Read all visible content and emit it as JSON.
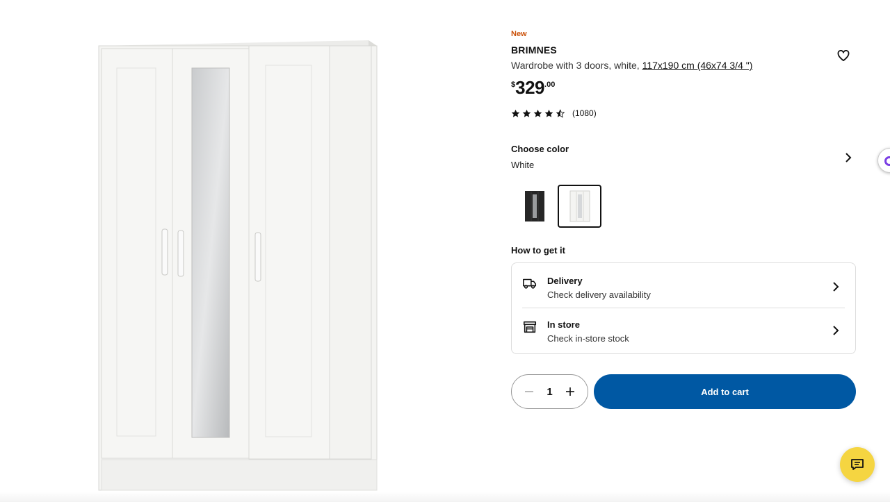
{
  "product": {
    "badge": "New",
    "name": "BRIMNES",
    "description": "Wardrobe with 3 doors, white,",
    "dimensions": "117x190 cm (46x74 3/4 \")",
    "price": {
      "currency": "$",
      "integer": "329",
      "decimal": ".00"
    },
    "rating": {
      "stars": 4.5,
      "count": "(1080)"
    },
    "favorite_icon": "heart-icon",
    "image_icon": "wardrobe-image"
  },
  "color": {
    "title": "Choose color",
    "selected": "White",
    "options": [
      {
        "name": "black",
        "swatch_color": "#2a2a2a",
        "selected": false
      },
      {
        "name": "white",
        "swatch_color": "#f4f4f2",
        "selected": true
      }
    ]
  },
  "get_it": {
    "title": "How to get it",
    "options": [
      {
        "label": "Delivery",
        "sub": "Check delivery availability",
        "icon": "truck-icon"
      },
      {
        "label": "In store",
        "sub": "Check in-store stock",
        "icon": "store-icon"
      }
    ]
  },
  "cart": {
    "quantity": "1",
    "add_label": "Add to cart",
    "button_color": "#0058a3"
  },
  "chat": {
    "icon": "chat-icon",
    "color": "#f5d541"
  }
}
